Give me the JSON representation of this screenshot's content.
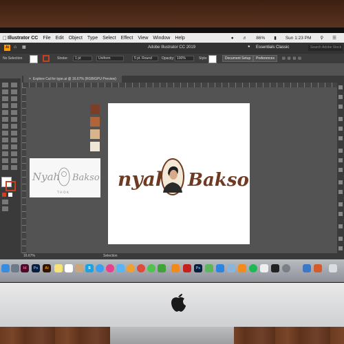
{
  "menubar": {
    "app_name": "Illustrator CC",
    "items": [
      "File",
      "Edit",
      "Object",
      "Type",
      "Select",
      "Effect",
      "View",
      "Window",
      "Help"
    ],
    "battery": "86%",
    "clock": "Sun 1:23 PM"
  },
  "app": {
    "badge": "Ai",
    "title": "Adobe Illustrator CC 2019",
    "workspace": "Essentials Classic",
    "search_placeholder": "Search Adobe Stock"
  },
  "control_bar": {
    "selection": "No Selection",
    "stroke_label": "Stroke:",
    "stroke_value": "1 pt",
    "uniform": "Uniform",
    "brush": "5 pt. Round",
    "opacity_label": "Opacity:",
    "opacity_value": "100%",
    "style_label": "Style:",
    "doc_setup": "Document Setup",
    "preferences": "Preferences"
  },
  "document": {
    "tab": "Explore Cal for type.ai @ 16.67% (RGB/GPU Preview)"
  },
  "artwork": {
    "logo_left": "nyah",
    "logo_right": "Bakso",
    "sketch_left": "Nyah",
    "sketch_right": "Bakso",
    "sketch_tag": "T H O K"
  },
  "swatches": [
    "#7b3f27",
    "#b0643a",
    "#d9b48a",
    "#f0e6d6"
  ],
  "status": {
    "zoom": "16.67%",
    "tool": "Selection"
  },
  "dock": {
    "icons": [
      "finder-icon",
      "launchpad-icon",
      "indesign-icon",
      "photoshop-icon",
      "illustrator-icon",
      "notes-icon",
      "calendar-icon",
      "contacts-icon",
      "skype-icon",
      "safari-icon",
      "itunes-icon",
      "mail-icon",
      "photos-icon",
      "chrome-icon",
      "messages-icon",
      "facetime-icon",
      "vlc-icon",
      "acrobat-icon",
      "lightroom-icon",
      "system-prefs-icon",
      "trash-icon"
    ],
    "labels": [
      "Id",
      "Ps",
      "Ai",
      "S",
      "Ps"
    ]
  }
}
